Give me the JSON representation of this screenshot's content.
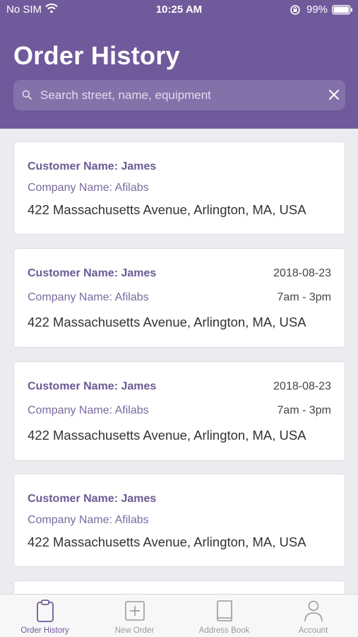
{
  "status_bar": {
    "carrier": "No SIM",
    "time": "10:25 AM",
    "battery": "99%"
  },
  "header": {
    "title": "Order History",
    "search": {
      "placeholder": "Search street, name, equipment",
      "value": "",
      "search_icon": "magnifier-icon",
      "clear_icon": "close-icon"
    }
  },
  "orders": [
    {
      "customer": "Customer Name: James",
      "company": "Company Name: Afilabs",
      "address": "422 Massachusetts Avenue, Arlington, MA, USA"
    },
    {
      "customer": "Customer Name: James",
      "company": "Company Name: Afilabs",
      "address": "422 Massachusetts Avenue, Arlington, MA, USA",
      "date": "2018-08-23",
      "hours": "7am - 3pm"
    },
    {
      "customer": "Customer Name: James",
      "company": "Company Name: Afilabs",
      "address": "422 Massachusetts Avenue, Arlington, MA, USA",
      "date": "2018-08-23",
      "hours": "7am - 3pm"
    },
    {
      "customer": "Customer Name: James",
      "company": "Company Name: Afilabs",
      "address": "422 Massachusetts Avenue, Arlington, MA, USA"
    }
  ],
  "tabbar": {
    "tabs": [
      {
        "label": "Order History",
        "icon": "clipboard-icon",
        "active": true
      },
      {
        "label": "New Order",
        "icon": "plus-square-icon",
        "active": false
      },
      {
        "label": "Address Book",
        "icon": "book-icon",
        "active": false
      },
      {
        "label": "Account",
        "icon": "person-icon",
        "active": false
      }
    ]
  },
  "colors": {
    "brand": "#715a9c",
    "tab_active": "#715a9c",
    "tab_inactive": "#9a9a9a"
  }
}
